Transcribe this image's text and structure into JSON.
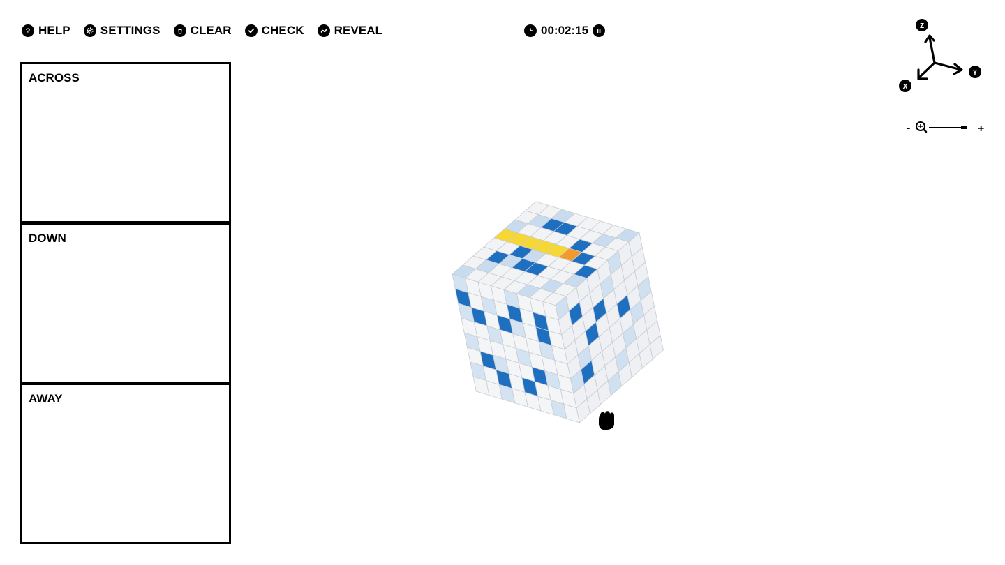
{
  "toolbar": {
    "help_label": "HELP",
    "settings_label": "SETTINGS",
    "clear_label": "CLEAR",
    "check_label": "CHECK",
    "reveal_label": "REVEAL"
  },
  "timer": {
    "value": "00:02:15"
  },
  "clues": {
    "across_title": "ACROSS",
    "down_title": "DOWN",
    "away_title": "AWAY"
  },
  "axes": {
    "z": "Z",
    "y": "Y",
    "x": "X"
  },
  "zoom": {
    "minus": "-",
    "plus": "+"
  },
  "colors": {
    "accent_blue": "#1f6fc1",
    "highlight_yellow": "#f7d733",
    "cursor_orange": "#f39a2e"
  }
}
